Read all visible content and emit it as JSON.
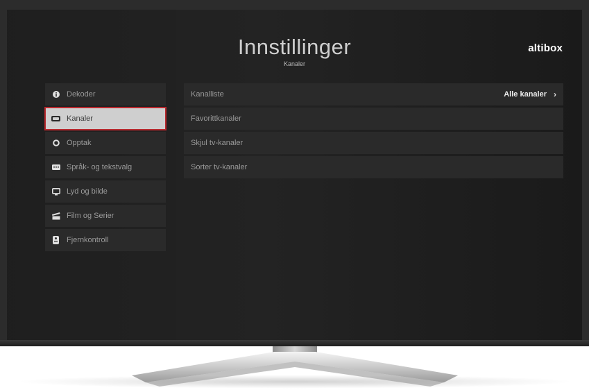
{
  "header": {
    "title": "Innstillinger",
    "subtitle": "Kanaler",
    "brand": "altibox"
  },
  "sidebar": {
    "items": [
      {
        "label": "Dekoder",
        "icon": "info-icon"
      },
      {
        "label": "Kanaler",
        "icon": "tv-channels-icon",
        "active": true
      },
      {
        "label": "Opptak",
        "icon": "record-icon"
      },
      {
        "label": "Språk- og tekstvalg",
        "icon": "subtitles-icon"
      },
      {
        "label": "Lyd og bilde",
        "icon": "monitor-icon"
      },
      {
        "label": "Film og Serier",
        "icon": "clapperboard-icon"
      },
      {
        "label": "Fjernkontroll",
        "icon": "remote-icon"
      }
    ]
  },
  "content": {
    "rows": [
      {
        "label": "Kanalliste",
        "value": "Alle kanaler"
      },
      {
        "label": "Favorittkanaler"
      },
      {
        "label": "Skjul tv-kanaler"
      },
      {
        "label": "Sorter tv-kanaler"
      }
    ]
  },
  "colors": {
    "screen_bg": "#1b1b1b",
    "item_bg": "#2a2a2a",
    "active_bg": "#cfcfcf",
    "focus_outline": "#b8282d"
  }
}
